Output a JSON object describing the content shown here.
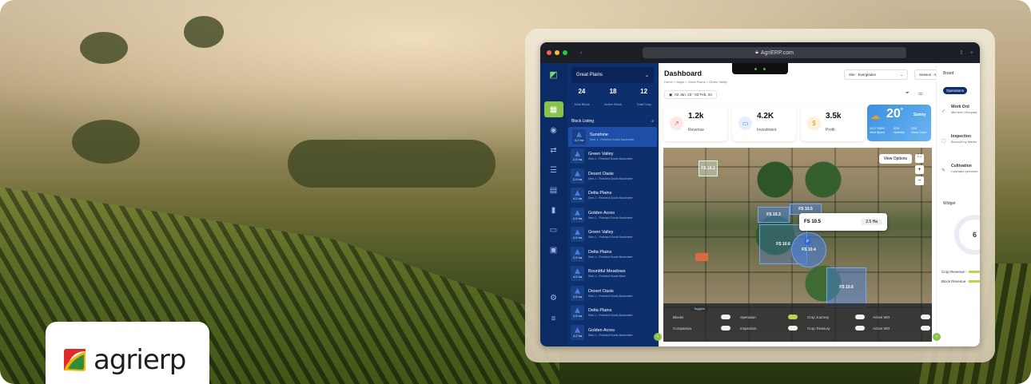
{
  "brand": {
    "name": "agrierp"
  },
  "browser": {
    "url": "AgriERP.com",
    "traffic": [
      "#ff5f57",
      "#febc2e",
      "#28c840"
    ]
  },
  "sidebar": {
    "region": "Great Plains",
    "stats": [
      {
        "value": "24",
        "label": "Total Block"
      },
      {
        "value": "18",
        "label": "Active Block"
      },
      {
        "value": "12",
        "label": "Total Crop"
      }
    ],
    "list_title": "Block Listing",
    "blocks": [
      {
        "name": "Sunshine",
        "sub": "Sem-1 - Finished Goods Backmeter",
        "area": "4.2 ha"
      },
      {
        "name": "Green Valley",
        "sub": "Sem-1 - Finished Goods Backmeter",
        "area": "2.5 ha"
      },
      {
        "name": "Desert Oasis",
        "sub": "Sem-1 - Finished Goods Backmeter",
        "area": "2.5 ha"
      },
      {
        "name": "Delta Plains",
        "sub": "Sem-1 - Finished Goods Backmeter",
        "area": "4.2 ha"
      },
      {
        "name": "Golden Acres",
        "sub": "Sem-1 - Finished Goods Backmeter",
        "area": "2.5 ha"
      },
      {
        "name": "Green Valley",
        "sub": "Sem-1 - Finished Goods Backmeter",
        "area": "2.5 ha"
      },
      {
        "name": "Delta Plains",
        "sub": "Sem-1 - Finished Goods Backmeter",
        "area": "2.5 ha"
      },
      {
        "name": "Bountiful Meadows",
        "sub": "Sem-1 - Finished Goods Back",
        "area": "4.2 ha"
      },
      {
        "name": "Desert Oasis",
        "sub": "Sem-1 - Finished Goods Backmeter",
        "area": "2.5 ha"
      },
      {
        "name": "Delta Plains",
        "sub": "Sem-1 - Finished Goods Backmeter",
        "area": "2.5 ha"
      },
      {
        "name": "Golden Acres",
        "sub": "Sem-1 - Finished Goods Backmeter",
        "area": "4.2 ha"
      }
    ]
  },
  "header": {
    "title": "Dashboard",
    "breadcrumb": "Home  >  Maps  >  Great Plains  >  Green Valley",
    "site": "Site : Everglades",
    "season": "Season : Winter 2023",
    "date_range": "02 Jan, 23 - 03 Feb, 23"
  },
  "kpis": [
    {
      "value": "1.2k",
      "label": "Revenue",
      "color": "#fde8e8",
      "icon": "trend-icon"
    },
    {
      "value": "4.2K",
      "label": "Investment",
      "color": "#e3effc",
      "icon": "wallet-icon"
    },
    {
      "value": "3.5k",
      "label": "Profit",
      "color": "#fdf2d8",
      "icon": "dollar-icon"
    }
  ],
  "weather": {
    "temp": "20",
    "unit": "°",
    "cond": "Sunny",
    "wind": "15.27 KM/H",
    "humidity": "32%",
    "cloud": "32%",
    "wind_label": "Wind Speed",
    "hum_label": "Humidity",
    "cloud_label": "Cloud Cover"
  },
  "map": {
    "view_options": "View Options",
    "fields": [
      "FS 10.2",
      "FS 10.3",
      "FS 10.5",
      "FS 10.6",
      "FS 10.4",
      "FS 10.6"
    ],
    "popup": {
      "name": "FS 10.5",
      "area": "2.5 Ha"
    },
    "toggles_title": "Toggles",
    "toggles": [
      {
        "label": "Blocks",
        "on": false
      },
      {
        "label": "Operation",
        "on": true
      },
      {
        "label": "Crop Journey",
        "on": false
      },
      {
        "label": "Active WO",
        "on": false
      },
      {
        "label": "Companion",
        "on": false
      },
      {
        "label": "Inspection",
        "on": false
      },
      {
        "label": "Crop Treasury",
        "on": false
      },
      {
        "label": "Active WO",
        "on": false
      }
    ]
  },
  "right": {
    "board": "Board",
    "tab": "Operations",
    "items": [
      {
        "title": "Work Ord",
        "sub": "Mid term Vineyard"
      },
      {
        "title": "Inspection",
        "sub": "Broccoli by Martin"
      },
      {
        "title": "Cultivation",
        "sub": "Cultivatio performe"
      }
    ],
    "widget": "Widget",
    "crop_revenue": "Crop Revenue -",
    "block_revenue": "Block Revenue -",
    "gauge_label": "6"
  }
}
